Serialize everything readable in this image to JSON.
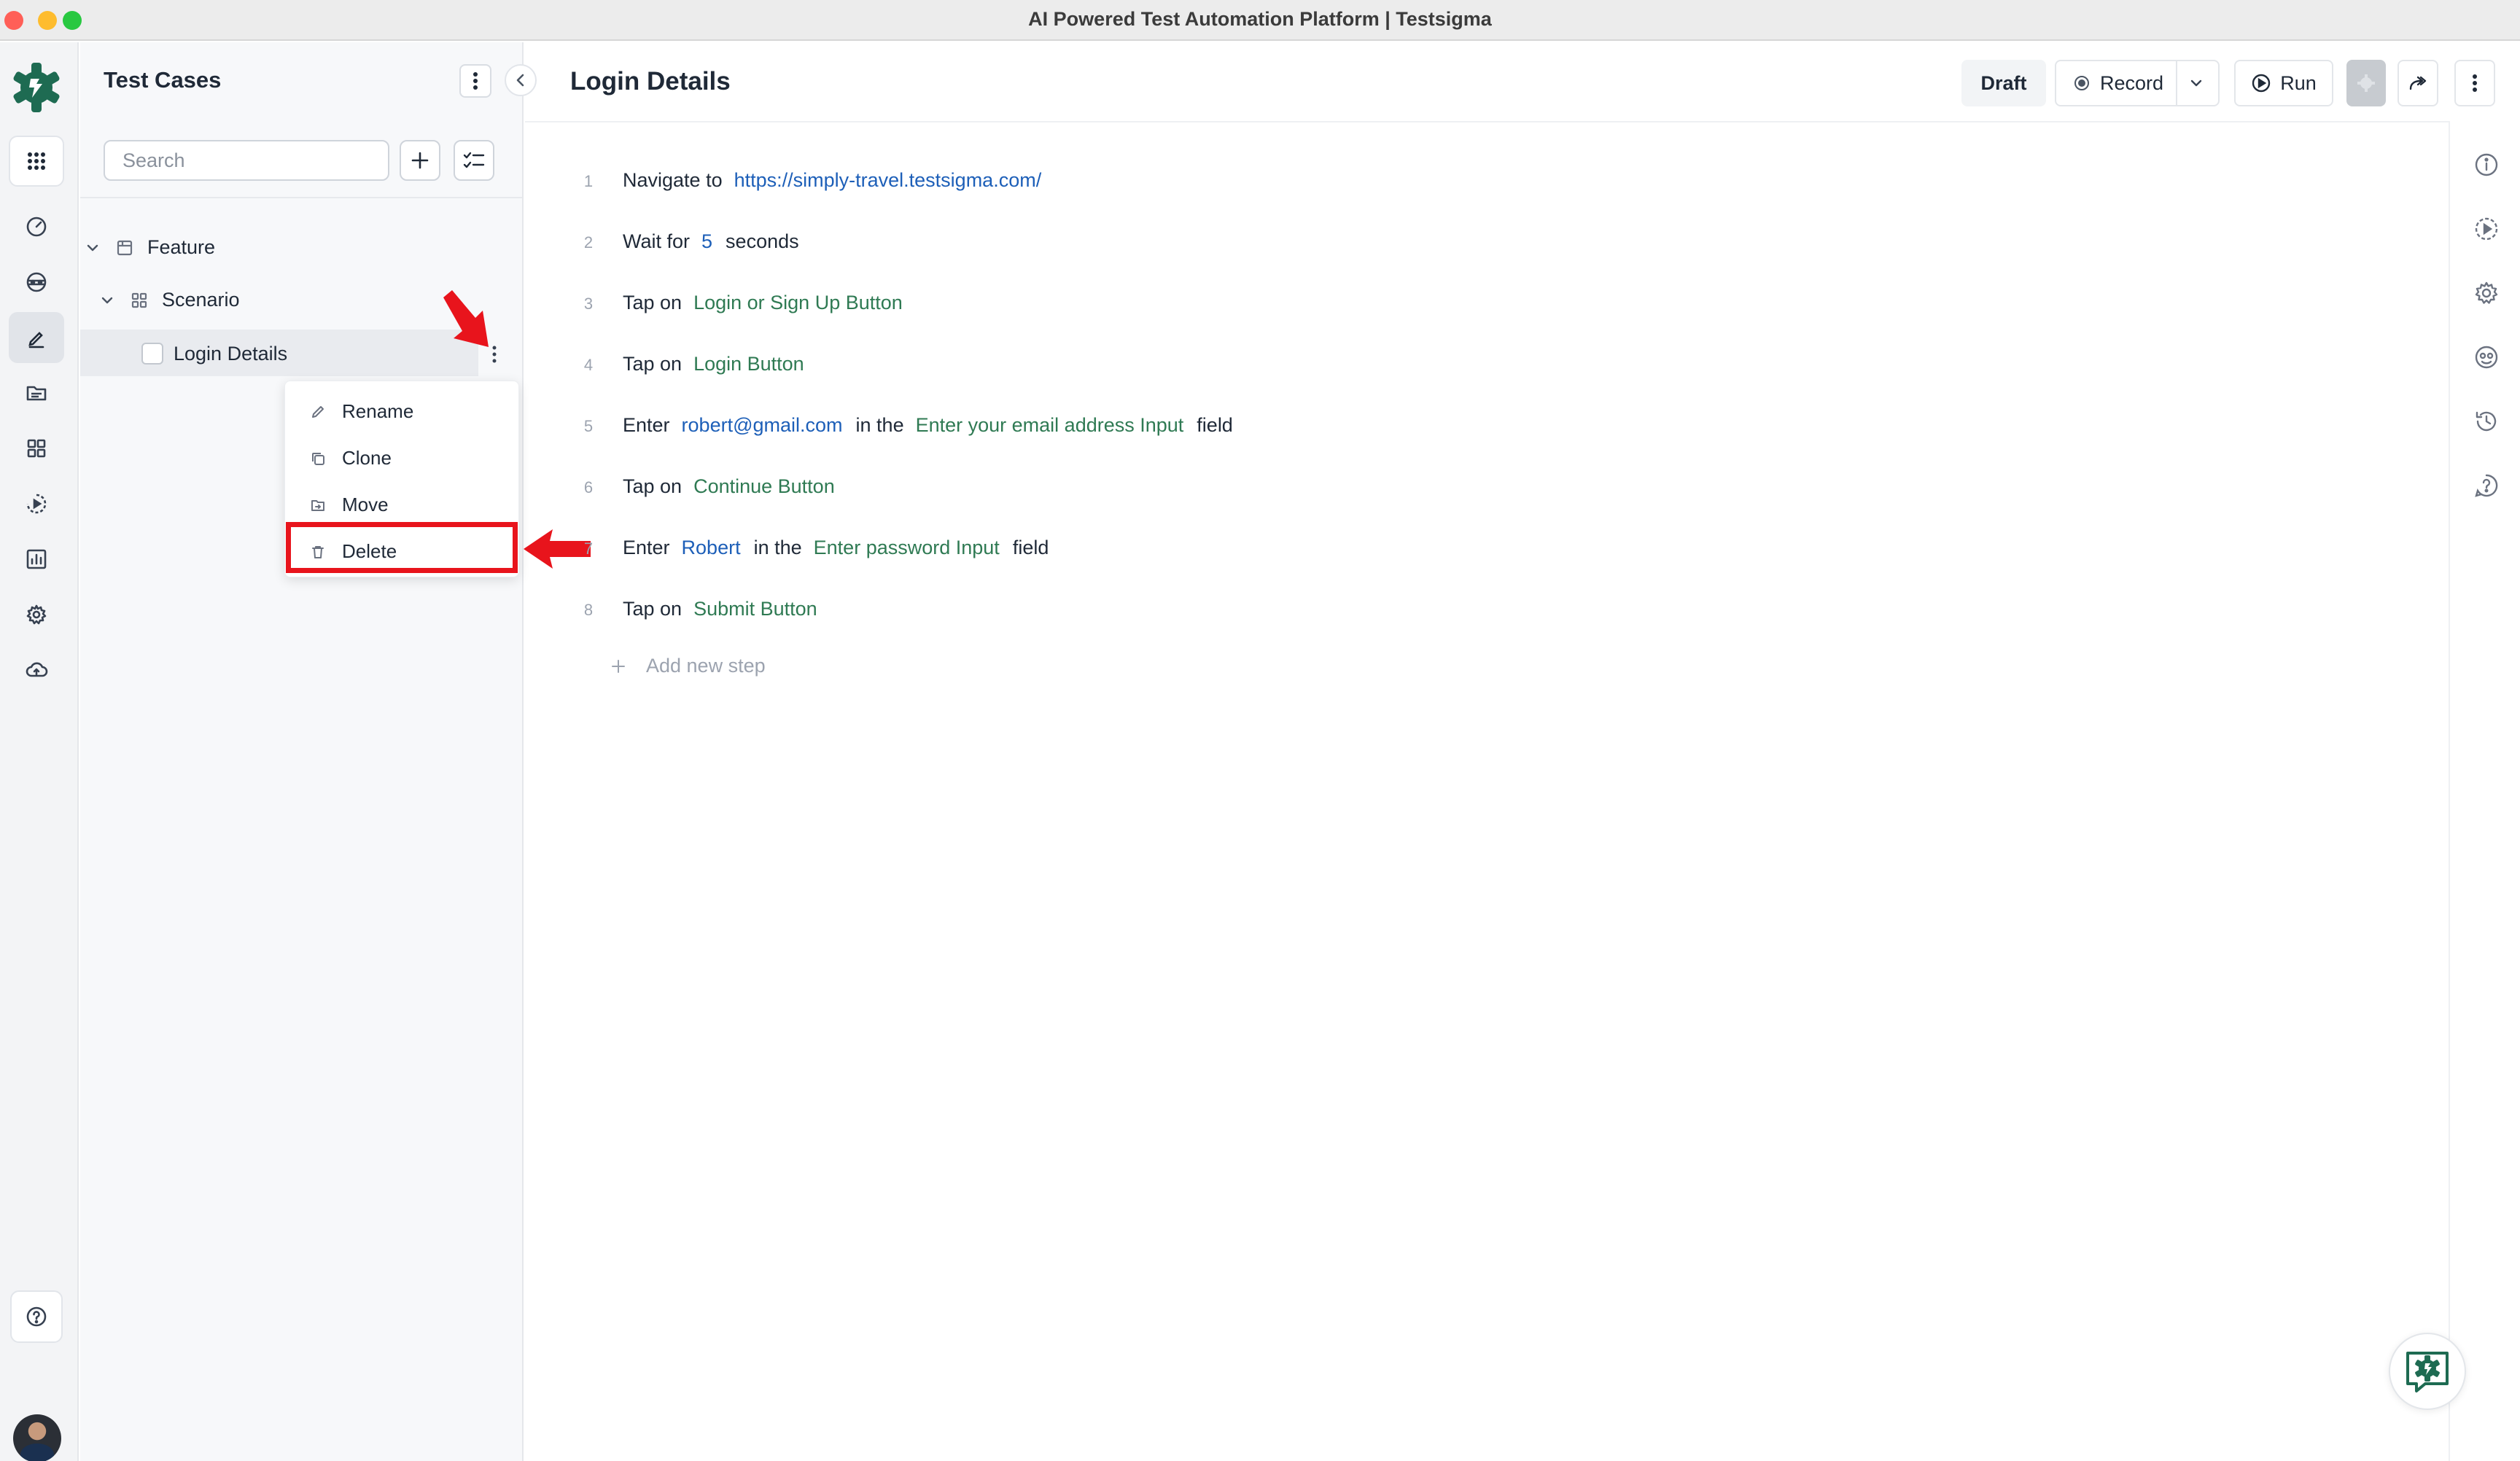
{
  "window": {
    "title": "AI Powered Test Automation Platform | Testsigma"
  },
  "rail": {
    "items": [
      "apps",
      "dashboard",
      "test-data",
      "test-cases",
      "suites",
      "elements",
      "runs",
      "reports",
      "settings",
      "uploads"
    ],
    "active": "test-cases"
  },
  "panel": {
    "title": "Test Cases",
    "search_placeholder": "Search",
    "tree": {
      "feature": "Feature",
      "scenario": "Scenario",
      "test_case": "Login Details"
    }
  },
  "context_menu": {
    "items": [
      {
        "label": "Rename",
        "icon": "pencil-icon"
      },
      {
        "label": "Clone",
        "icon": "copy-icon"
      },
      {
        "label": "Move",
        "icon": "folder-move-icon"
      },
      {
        "label": "Delete",
        "icon": "trash-icon"
      }
    ],
    "highlighted": "Delete"
  },
  "main": {
    "title": "Login Details",
    "status": "Draft",
    "record_label": "Record",
    "run_label": "Run",
    "add_step_label": "Add new step",
    "steps": [
      {
        "num": "1",
        "parts": [
          {
            "t": "kw",
            "v": "Navigate to"
          },
          {
            "t": "val",
            "v": "https://simply-travel.testsigma.com/"
          }
        ]
      },
      {
        "num": "2",
        "parts": [
          {
            "t": "kw",
            "v": "Wait for"
          },
          {
            "t": "val",
            "v": "5"
          },
          {
            "t": "kw",
            "v": "seconds"
          }
        ]
      },
      {
        "num": "3",
        "parts": [
          {
            "t": "kw",
            "v": "Tap on"
          },
          {
            "t": "el",
            "v": "Login or Sign Up Button"
          }
        ]
      },
      {
        "num": "4",
        "parts": [
          {
            "t": "kw",
            "v": "Tap on"
          },
          {
            "t": "el",
            "v": "Login Button"
          }
        ]
      },
      {
        "num": "5",
        "parts": [
          {
            "t": "kw",
            "v": "Enter"
          },
          {
            "t": "val",
            "v": "robert@gmail.com"
          },
          {
            "t": "kw",
            "v": "in the"
          },
          {
            "t": "el",
            "v": "Enter your email address Input"
          },
          {
            "t": "kw",
            "v": "field"
          }
        ]
      },
      {
        "num": "6",
        "parts": [
          {
            "t": "kw",
            "v": "Tap on"
          },
          {
            "t": "el",
            "v": "Continue Button"
          }
        ]
      },
      {
        "num": "7",
        "parts": [
          {
            "t": "kw",
            "v": "Enter"
          },
          {
            "t": "val",
            "v": "Robert"
          },
          {
            "t": "kw",
            "v": "in the"
          },
          {
            "t": "el",
            "v": "Enter password Input"
          },
          {
            "t": "kw",
            "v": "field"
          }
        ]
      },
      {
        "num": "8",
        "parts": [
          {
            "t": "kw",
            "v": "Tap on"
          },
          {
            "t": "el",
            "v": "Submit Button"
          }
        ]
      }
    ]
  },
  "colors": {
    "accent_green": "#1e6b52",
    "value_blue": "#1d5fb8",
    "element_green": "#2f7a53",
    "annotation_red": "#e8141c"
  }
}
